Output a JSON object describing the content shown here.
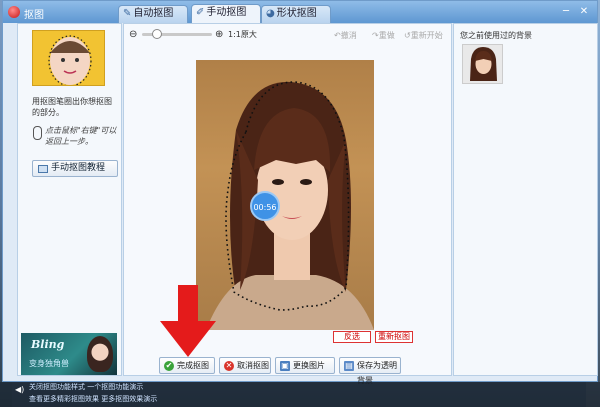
{
  "window": {
    "title": "抠图",
    "minimize": "─",
    "close": "✕"
  },
  "tabs": [
    {
      "label": "自动抠图",
      "icon": "magic-wand-icon"
    },
    {
      "label": "手动抠图",
      "icon": "cursor-icon"
    },
    {
      "label": "形状抠图",
      "icon": "shape-icon"
    }
  ],
  "left_panel": {
    "description": "用抠图笔圈出你想抠图的部分。",
    "mouse_tip": "点击鼠标\"右键\"可以返回上一步。",
    "tutorial_button": "手动抠图教程",
    "ad": {
      "title": "Bling",
      "subtitle": "变身独角兽"
    }
  },
  "toolbar": {
    "zoom_actual": "1:1原大",
    "undo": "撤消",
    "redo": "重做",
    "restart": "重新开始"
  },
  "canvas": {
    "timer": "00:56",
    "invert_button": "反选",
    "redo_matting_button": "重新抠图"
  },
  "history": {
    "title": "您之前使用过的背景"
  },
  "actions": {
    "finish": "完成抠图",
    "cancel": "取消抠图",
    "change_image": "更换图片",
    "save_transparent": "保存为透明背景"
  },
  "status": {
    "line1": "关闭抠图功能样式 一个抠图功能演示",
    "line2": "查看更多精彩抠图效果 更多抠图效果演示"
  },
  "colors": {
    "accent": "#5e97d2",
    "arrow": "#e41b1b",
    "finish_icon": "#3aa33a",
    "cancel_icon": "#d9342b"
  }
}
